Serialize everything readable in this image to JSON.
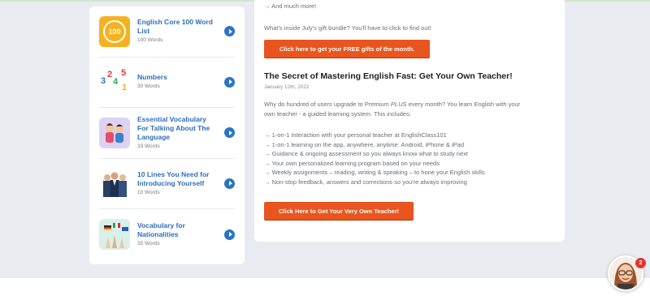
{
  "sidebar": {
    "items": [
      {
        "title": "English Core 100 Word List",
        "count": "100 Words",
        "icon": "100-badge-icon",
        "thumb_label": "100",
        "color": "#f5b21e"
      },
      {
        "title": "Numbers",
        "count": "30 Words",
        "icon": "numbers-icon",
        "digits": [
          "3",
          "2",
          "4",
          "5",
          "1"
        ],
        "color": "#ffffff"
      },
      {
        "title": "Essential Vocabulary For Talking About The Language",
        "count": "33 Words",
        "icon": "speaking-people-icon",
        "color": "#dcd2f2"
      },
      {
        "title": "10 Lines You Need for Introducing Yourself",
        "count": "10 Words",
        "icon": "business-people-icon",
        "color": "#ffffff"
      },
      {
        "title": "Vocabulary for Nationalities",
        "count": "35 Words",
        "icon": "flags-icon",
        "color": "#d8efea"
      }
    ]
  },
  "main": {
    "more_line": "→ And much more!",
    "gift_line": "What's inside July's gift bundle? You'll have to click to find out!",
    "gift_button": "Click here to get your FREE gifts of the month.",
    "post_title": "The Secret of Mastering English Fast: Get Your Own Teacher!",
    "post_date": "January 12th, 2022",
    "intro_1": "Why do hundred of users upgrade to Premium ",
    "intro_plus": "PLUS",
    "intro_2": " every month? You learn English with your",
    "intro_3": "own teacher - a guided learning system. This includes:",
    "bullets": [
      "→ 1-on-1 Interaction with your personal teacher at EnglishClass101",
      "→ 1-on-1 learning on the app, anywhere, anytime: Android, iPhone & iPad",
      "→ Guidance & ongoing assessment so you always know what to study next",
      "→ Your own personalized learning program based on your needs",
      "→ Weekly assignments – reading, writing & speaking – to hone your English skills",
      "→ Non-stop feedback, answers and corrections so you're always improving"
    ],
    "teacher_button": "Click Here to Get Your Very Own Teacher!"
  },
  "chat": {
    "badge_count": "2",
    "icon": "teacher-avatar-icon"
  },
  "colors": {
    "accent_orange": "#e8551e",
    "link_blue": "#2d6fb8",
    "play_blue": "#2a74c4"
  }
}
